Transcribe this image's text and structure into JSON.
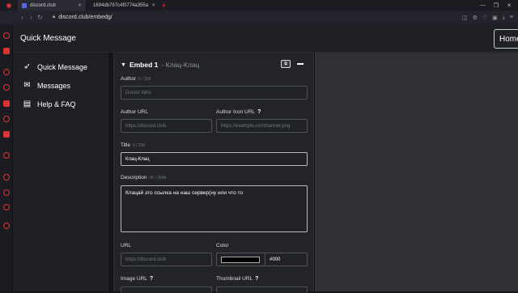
{
  "browser": {
    "tabs": [
      {
        "title": "discord.club",
        "active": true
      },
      {
        "title": "1694db797c4f0774a355a",
        "active": false
      }
    ],
    "new_tab": "+",
    "url": "discord.club/embedg/",
    "window_controls": [
      "—",
      "❐",
      "✕"
    ]
  },
  "app": {
    "title": "Quick Message",
    "home_button": "Home"
  },
  "nav": {
    "items": [
      {
        "label": "Quick Message",
        "icon": "rocket-icon"
      },
      {
        "label": "Messages",
        "icon": "messages-icon"
      },
      {
        "label": "Help & FAQ",
        "icon": "book-icon"
      }
    ]
  },
  "embed": {
    "title": "Embed 1",
    "subtitle": " - Клац-Клац",
    "author": {
      "label": "Author",
      "count": "0 / 256",
      "placeholder": "Doctor Who",
      "value": ""
    },
    "author_url": {
      "label": "Author URL",
      "placeholder": "https://discord.club"
    },
    "author_icon_url": {
      "label": "Author Icon URL",
      "help": "?",
      "placeholder": "https://example.com/banner.png"
    },
    "title_field": {
      "label": "Title",
      "count": "9 / 256",
      "value": "Клац-Клац"
    },
    "description": {
      "label": "Description",
      "count": "45 / 2048",
      "value": "Клацай это ссылка на наш сервер(ну или что то"
    },
    "url": {
      "label": "URL",
      "placeholder": "https://discord.club"
    },
    "color": {
      "label": "Color",
      "value": "#000",
      "swatch": "#000000"
    },
    "image_url": {
      "label": "Image URL",
      "help": "?"
    },
    "thumbnail_url": {
      "label": "Thumbnail URL",
      "help": "?"
    }
  },
  "colors": {
    "accent": "#dd3333",
    "panel": "#23242a",
    "preview_bg": "#2f3136"
  }
}
